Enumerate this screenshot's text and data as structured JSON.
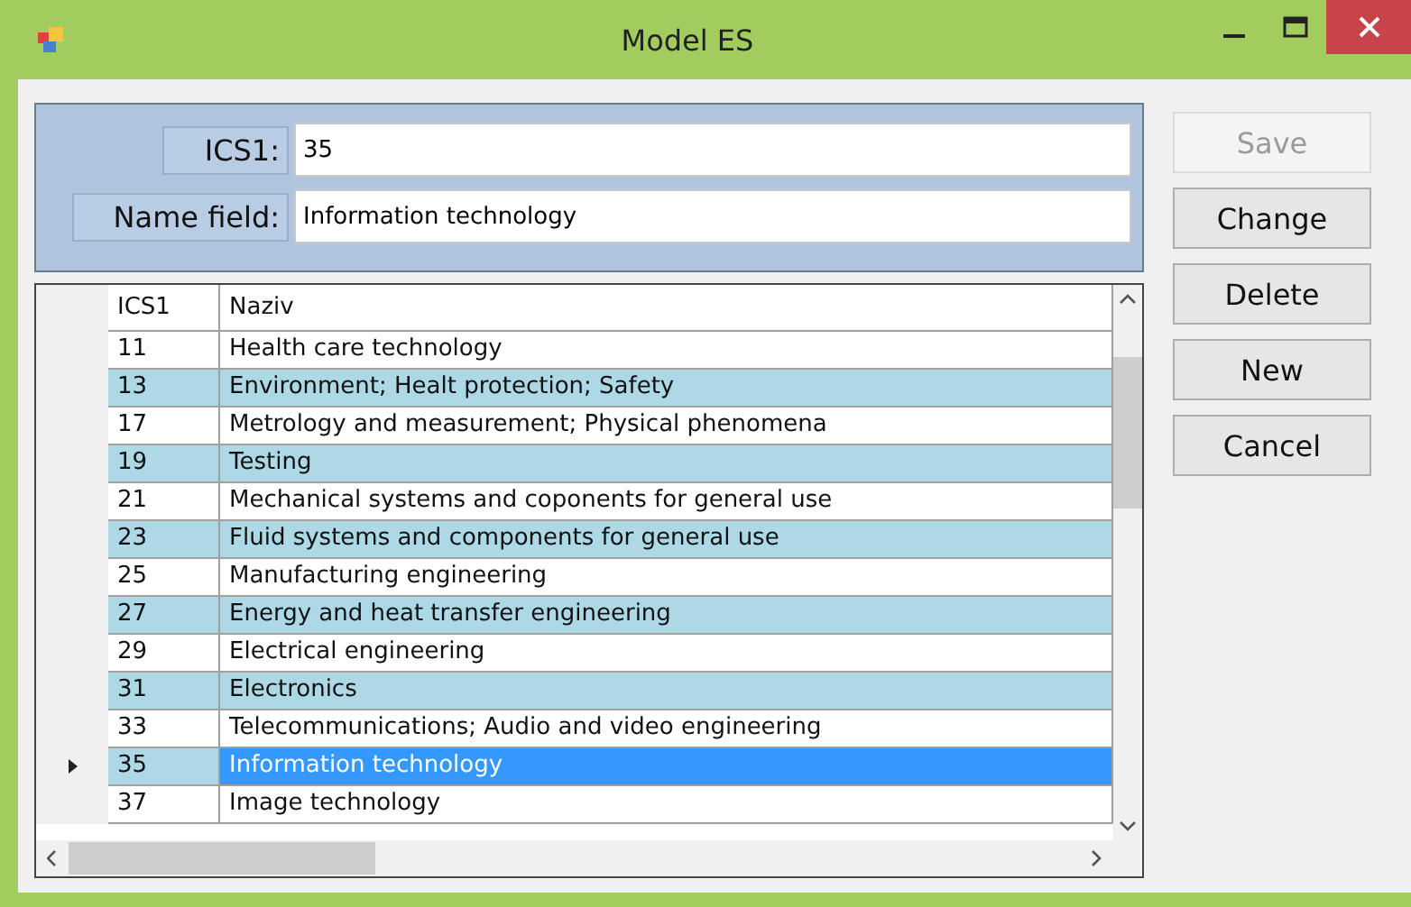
{
  "window": {
    "title": "Model ES"
  },
  "form": {
    "fields": [
      {
        "label": "ICS1:",
        "value": "35"
      },
      {
        "label": "Name field:",
        "value": "Information technology"
      }
    ]
  },
  "table": {
    "columns": [
      "ICS1",
      "Naziv"
    ],
    "rows": [
      {
        "cells": [
          "11",
          "Health care technology"
        ],
        "selected": false
      },
      {
        "cells": [
          "13",
          "Environment; Healt protection; Safety"
        ],
        "selected": false
      },
      {
        "cells": [
          "17",
          "Metrology and measurement; Physical phenomena"
        ],
        "selected": false
      },
      {
        "cells": [
          "19",
          "Testing"
        ],
        "selected": false
      },
      {
        "cells": [
          "21",
          "Mechanical systems and coponents for general use"
        ],
        "selected": false
      },
      {
        "cells": [
          "23",
          "Fluid systems and components for general use"
        ],
        "selected": false
      },
      {
        "cells": [
          "25",
          "Manufacturing engineering"
        ],
        "selected": false
      },
      {
        "cells": [
          "27",
          "Energy and heat transfer engineering"
        ],
        "selected": false
      },
      {
        "cells": [
          "29",
          "Electrical engineering"
        ],
        "selected": false
      },
      {
        "cells": [
          "31",
          "Electronics"
        ],
        "selected": false
      },
      {
        "cells": [
          "33",
          "Telecommunications; Audio and video engineering"
        ],
        "selected": false
      },
      {
        "cells": [
          "35",
          "Information technology"
        ],
        "selected": true
      },
      {
        "cells": [
          "37",
          "Image technology"
        ],
        "selected": false
      }
    ]
  },
  "buttons": [
    {
      "label": "Save",
      "disabled": true
    },
    {
      "label": "Change",
      "disabled": false
    },
    {
      "label": "Delete",
      "disabled": false
    },
    {
      "label": "New",
      "disabled": false
    },
    {
      "label": "Cancel",
      "disabled": false
    }
  ]
}
